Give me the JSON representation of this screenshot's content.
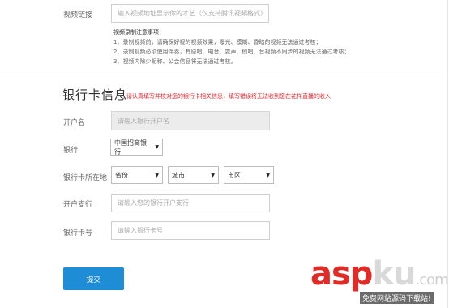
{
  "video": {
    "label": "视频链接",
    "placeholder": "输入视频地址显示你的才艺（仅支持腾讯视频格式）",
    "notes_title": "视频录制注意事项：",
    "notes": [
      "1、录制视频前，请确保好视的视频效果，曝光、模糊、昏暗的视频无法通过考核；",
      "2、录制视频必须使用伴奏，有原唱、电音、变声、假唱、音视频不同步的视频无法通过考核；",
      "3、视频内除少昵称、公会信息将无法通过考核。"
    ]
  },
  "bank": {
    "title": "银行卡信息",
    "warning": "请认真填写并核对您的银行卡相关信息，填写错误将无法收到您在花样直播的收入",
    "account_name": {
      "label": "开户名",
      "placeholder": "请输入银行开户名"
    },
    "bank": {
      "label": "银行",
      "value": "中国招商银行"
    },
    "location": {
      "label": "银行卡所在地",
      "province": "省份",
      "city": "城市",
      "district": "市区"
    },
    "branch": {
      "label": "开户支行",
      "placeholder": "请输入您的银行开户支行"
    },
    "card_number": {
      "label": "银行卡号",
      "placeholder": "请输入银行卡号"
    }
  },
  "submit_label": "提交",
  "watermark": {
    "brand_red": "asp",
    "brand_gray": "ku",
    "domain_suffix": ".com",
    "subtitle": "免费网站源码下载站!"
  },
  "colors": {
    "primary_button": "#1e8dd6",
    "warning_text": "#e8252a",
    "watermark_red": "#e02b27"
  }
}
